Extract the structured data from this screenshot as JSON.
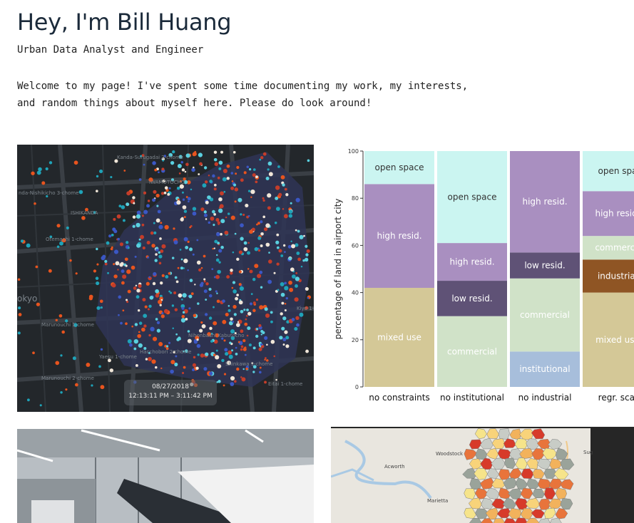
{
  "header": {
    "title": "Hey, I'm Bill Huang",
    "subtitle": "Urban Data Analyst and Engineer",
    "intro": "Welcome to my page! I've spent some time documenting my work, my interests, and random things about myself here. Please do look around!"
  },
  "gallery": {
    "map1": {
      "date": "08/27/2018",
      "time_range": "12:13:11 PM  –  3:11:42 PM",
      "place_labels": [
        "Kanda-Surugadai 2-chome",
        "IWAMOTOCHO",
        "nda-Nishikicho 3-chome",
        "ISHIKANDA",
        "Otemachi 1-chome",
        "okyo",
        "Marunouchi 1-chome",
        "Marunouchi 2-chome",
        "Yaesu 1-chome",
        "Kiyo 1-chome",
        "Hacchobori 2-chome",
        "Eitai 1-chome",
        "Shinkawa 1-chome",
        "Nihonbashi Kabutocho"
      ]
    },
    "photo": {},
    "map2": {
      "labels": [
        "Woodstock",
        "Acworth",
        "Marietta",
        "Sug"
      ]
    }
  },
  "chart_data": {
    "type": "bar",
    "stacked": true,
    "ylabel": "percentage of land in airport city",
    "ylim": [
      0,
      100
    ],
    "yticks": [
      0,
      20,
      40,
      60,
      80,
      100
    ],
    "categories": [
      "no constraints",
      "no institutional",
      "no industrial",
      "regr. scal"
    ],
    "series": [
      {
        "name": "institutional",
        "color": "#a7bedb",
        "values": [
          0,
          0,
          15,
          0
        ]
      },
      {
        "name": "mixed use",
        "color": "#d4c897",
        "values": [
          42,
          0,
          0,
          40
        ]
      },
      {
        "name": "commercial",
        "color": "#d0e2c8",
        "values": [
          0,
          30,
          31,
          0
        ]
      },
      {
        "name": "industrial",
        "color": "#8f5524",
        "values": [
          0,
          0,
          0,
          14
        ]
      },
      {
        "name": "low resid.",
        "color": "#5f5276",
        "values": [
          0,
          15,
          11,
          0
        ]
      },
      {
        "name": "commercial",
        "color": "#d0e2c8",
        "values": [
          0,
          0,
          0,
          10
        ]
      },
      {
        "name": "high resid.",
        "color": "#a98fc0",
        "values": [
          44,
          16,
          43,
          19
        ]
      },
      {
        "name": "open space",
        "color": "#cbf5f1",
        "values": [
          14,
          39,
          0,
          17
        ]
      }
    ],
    "segment_labels": [
      [
        "mixed use",
        "high resid.",
        "open space"
      ],
      [
        "commercial",
        "low resid.",
        "high resid.",
        "open space"
      ],
      [
        "institutional",
        "commercial",
        "low resid.",
        "high resid."
      ],
      [
        "mixed use",
        "industrial",
        "commerce",
        "high resid.",
        "open spa"
      ]
    ]
  }
}
